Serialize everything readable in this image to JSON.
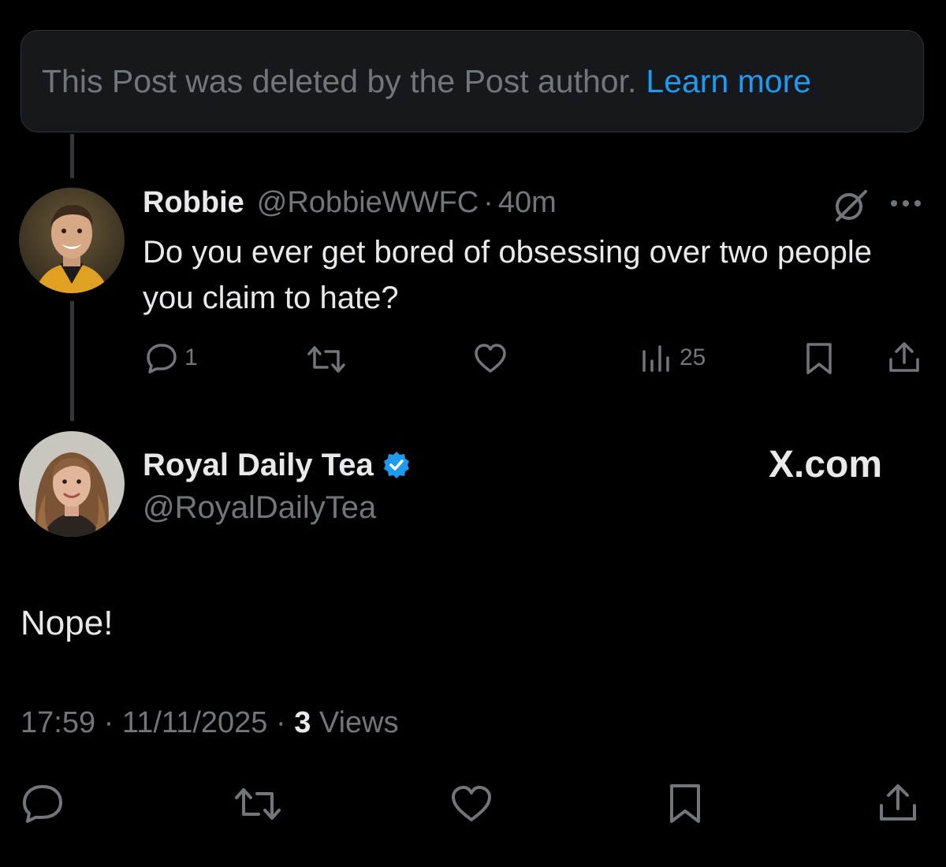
{
  "deleted_notice": {
    "text": "This Post was deleted by the Post author.",
    "link": "Learn more"
  },
  "reply_post": {
    "display_name": "Robbie",
    "handle": "@RobbieWWFC",
    "separator": "·",
    "time": "40m",
    "text": "Do you ever get bored of obsessing over two people you claim to hate?",
    "actions": {
      "reply_count": "1",
      "retweet_count": "",
      "like_count": "",
      "views_count": "25"
    },
    "icons": [
      "reply-icon",
      "retweet-icon",
      "like-icon",
      "views-icon",
      "bookmark-icon",
      "share-icon",
      "grok-icon",
      "more-icon"
    ]
  },
  "main_post": {
    "display_name": "Royal Daily Tea",
    "handle": "@RoyalDailyTea",
    "verified": true,
    "watermark": "X.com",
    "text": "Nope!",
    "time": "17:59",
    "separator": "·",
    "date": "11/11/2025",
    "views_count": "3",
    "views_label": "Views",
    "icons": [
      "reply-icon",
      "retweet-icon",
      "like-icon",
      "bookmark-icon",
      "share-icon"
    ]
  },
  "colors": {
    "background": "#000000",
    "text_primary": "#e7e9ea",
    "text_secondary": "#71767b",
    "link": "#1d9bf0",
    "card_bg": "#16181c",
    "verified_badge": "#1d9bf0"
  }
}
